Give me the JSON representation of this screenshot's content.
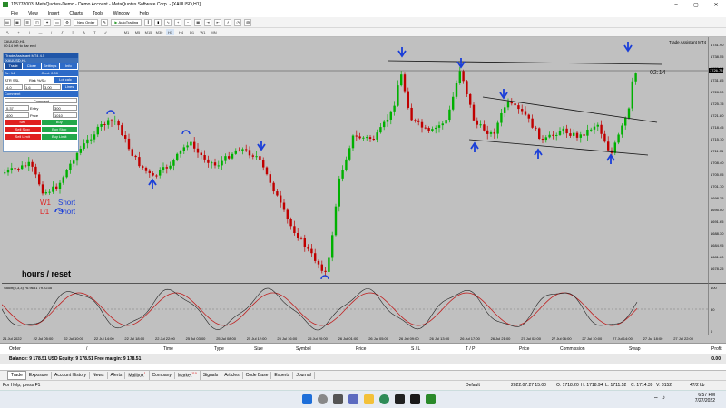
{
  "window": {
    "title": "115778003: MetaQuotes-Demo - Demo Account - MetaQuotes Software Corp. - [XAUUSD,H1]"
  },
  "menu": [
    "File",
    "View",
    "Insert",
    "Charts",
    "Tools",
    "Window",
    "Help"
  ],
  "toolbar": {
    "new_order": "New Order",
    "auto_trading": "AutoTrading",
    "timeframes": [
      "M1",
      "M5",
      "M15",
      "M30",
      "H1",
      "H4",
      "D1",
      "W1",
      "MN"
    ]
  },
  "chart": {
    "symbol_label": "XAUUSD,H1",
    "subtitle": "00:14 left to bar end",
    "trade_assistant_label": "Trade Assistant MT4",
    "timer": "02:14",
    "overlay_note": "hours / reset",
    "mtf_labels": {
      "w1": "W1",
      "d1": "D1",
      "short1": "Short",
      "short2": "Short"
    },
    "y_ticks": [
      "1741.90",
      "1738.55",
      "1735.20",
      "1731.85",
      "1728.50",
      "1725.15",
      "1721.80",
      "1718.45",
      "1715.10",
      "1711.75",
      "1708.40",
      "1705.05",
      "1701.70",
      "1698.35",
      "1695.00",
      "1691.65",
      "1688.30",
      "1684.95",
      "1681.60",
      "1678.25"
    ],
    "price_tag": "1726.73",
    "x_ticks": [
      "21 Jul 2022",
      "22 Jul 05:00",
      "22 Jul 10:00",
      "22 Jul 14:00",
      "22 Jul 18:00",
      "22 Jul 22:00",
      "25 Jul 03:00",
      "25 Jul 08:00",
      "25 Jul 12:00",
      "25 Jul 16:00",
      "25 Jul 20:00",
      "26 Jul 01:00",
      "26 Jul 05:00",
      "26 Jul 09:00",
      "26 Jul 13:00",
      "26 Jul 17:00",
      "26 Jul 21:00",
      "27 Jul 02:00",
      "27 Jul 06:00",
      "27 Jul 10:00",
      "27 Jul 14:00",
      "27 Jul 18:00",
      "27 Jul 22:00"
    ],
    "indicator_label": "Stoch(5,3,3) 76.9681 79.2235",
    "indicator_ticks": [
      "100",
      "50",
      "0"
    ]
  },
  "trade_panel": {
    "header": "Trade Assistant MT4 4.5",
    "sub_header": "XAUUSD,H1",
    "tabs": [
      "Trade",
      "Close",
      "Settings",
      "Info"
    ],
    "sl_label": "Sz: 14",
    "cont_label": "Cont: 0.00",
    "lot_label": "Lot calc",
    "risk_label": "Risk %/Su",
    "atr_label": "ATR SSL",
    "risk_value": "3.00",
    "lines_label": "Lines",
    "f1": "4.0",
    "f2": "1.6",
    "comment_label": "Comment",
    "comment_value": "Comment",
    "tp_label": "0.37",
    "entry_label": "Entry",
    "entry_value": "300",
    "volume": "400",
    "price_label": "Price",
    "price_value": "1010",
    "sell_label": "Sell",
    "buy_label": "Buy",
    "sell_stop": "Sell Stop",
    "buy_stop": "Buy Stop",
    "sell_limit": "Sell Limit",
    "buy_limit": "Buy Limit"
  },
  "terminal": {
    "columns": [
      "Order",
      "/",
      "Time",
      "Type",
      "Size",
      "Symbol",
      "Price",
      "S / L",
      "T / P",
      "Price",
      "Commission",
      "Swap",
      "Profit"
    ],
    "balance_text": "Balance: 9 178.51 USD  Equity: 9 178.51  Free margin: 9 178.51",
    "profit_value": "0.00",
    "tabs": [
      "Trade",
      "Exposure",
      "Account History",
      "News",
      "Alerts",
      "Mailbox",
      "Company",
      "Market",
      "Signals",
      "Articles",
      "Code Base",
      "Experts",
      "Journal"
    ],
    "mailbox_badge": "1",
    "market_badge": "110"
  },
  "status": {
    "help": "For Help, press F1",
    "profile": "Default",
    "datetime": "2022.07.27 15:00",
    "open": "O: 1718.20",
    "high": "H: 1718.94",
    "low": "L: 1711.52",
    "close": "C: 1714.39",
    "volume": "V: 8152",
    "traffic": "47/2 kb"
  },
  "taskbar": {
    "time": "6:57 PM",
    "date": "7/27/2022"
  },
  "colors": {
    "chart_bg": "#c0c0c0",
    "bull": "#00b000",
    "bear": "#c00000",
    "arrow": "#1a3ed8"
  }
}
